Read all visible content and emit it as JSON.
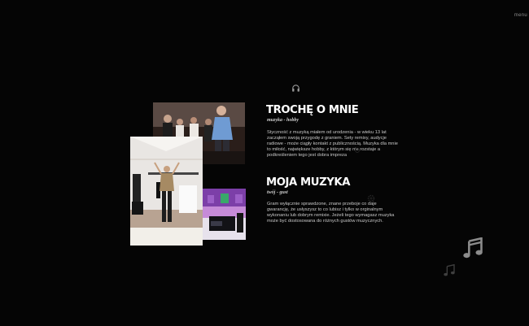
{
  "nav": {
    "menu_label": "menu"
  },
  "about": {
    "title": "TROCHĘ O MNIE",
    "subtitle": "muzyka - hobby",
    "text": "Styczność z muzyką miałem od urodzenia - w wieku 13 lat zacząłem swoją przygodę z graniem. Sety remixy, audycje radiowe - może ciągły kontakt z publicznością. Muzyka dla mnie to miłość, największe hobby, z którym się nie rozstaje a podkreśleniem tego jest dobra impreza"
  },
  "music": {
    "title": "MOJA MUZYKA",
    "subtitle": "twój - gust",
    "text": "Gram wyłącznie sprawdzone, znane przeboje co daje gwarancję, że usłyszysz to co lubisz i tylko w orginalnym wykonaniu lub dobrym remixie. Jeżeli tego wymagasz muzyka może być dostosowana do różnych gustów muzycznych."
  },
  "icons": [
    "headphones-icon",
    "gear-icon",
    "music-note-icon",
    "music-note-small-icon"
  ],
  "colors": {
    "background": "#050505",
    "heading": "#ffffff",
    "body_text": "#c9c9c9"
  }
}
